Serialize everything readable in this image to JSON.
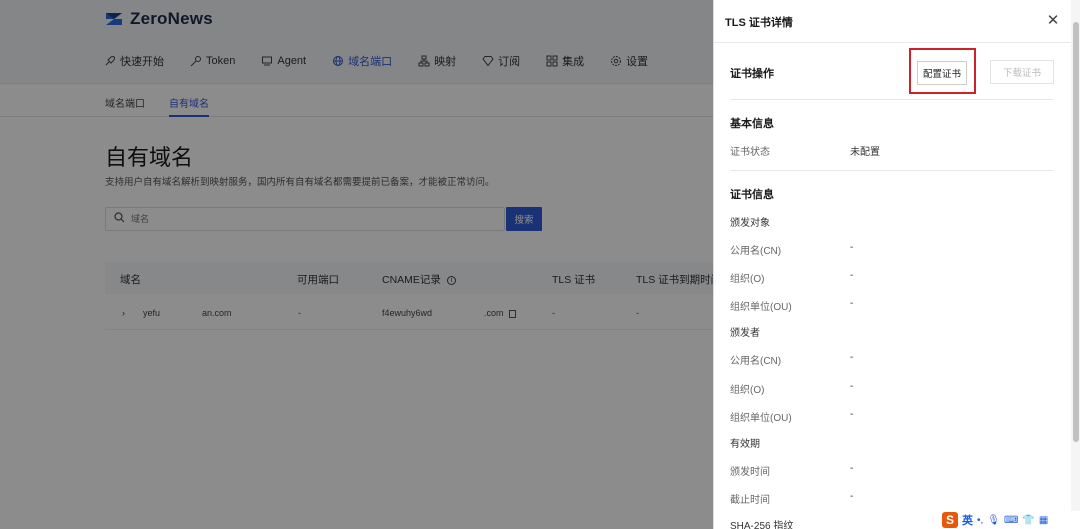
{
  "app": {
    "logo_text": "ZeroNews",
    "nav": [
      {
        "label": "快速开始",
        "icon": "rocket-icon"
      },
      {
        "label": "Token",
        "icon": "key-icon"
      },
      {
        "label": "Agent",
        "icon": "monitor-icon"
      },
      {
        "label": "域名端口",
        "icon": "globe-icon",
        "active": true
      },
      {
        "label": "映射",
        "icon": "network-icon"
      },
      {
        "label": "订阅",
        "icon": "diamond-icon"
      },
      {
        "label": "集成",
        "icon": "grid-icon"
      },
      {
        "label": "设置",
        "icon": "gear-icon"
      }
    ],
    "subtabs": [
      {
        "label": "域名端口"
      },
      {
        "label": "自有域名",
        "active": true
      }
    ],
    "page_title": "自有域名",
    "page_desc": "支持用户自有域名解析到映射服务，国内所有自有域名都需要提前已备案，才能被正常访问。",
    "search": {
      "placeholder": "域名",
      "button": "搜索"
    },
    "table": {
      "headers": [
        "域名",
        "可用端口",
        "CNAME记录",
        "TLS 证书",
        "TLS 证书到期时间"
      ],
      "rows": [
        {
          "domain_prefix": "yefu",
          "domain_suffix": "an.com",
          "port": "-",
          "cname_prefix": "f4ewuhy6wd",
          "cname_suffix": ".com",
          "tls": "-",
          "expire": "-"
        }
      ]
    }
  },
  "drawer": {
    "title": "TLS 证书详情",
    "ops_title": "证书操作",
    "config_btn": "配置证书",
    "download_btn": "下载证书",
    "basic_title": "基本信息",
    "status_label": "证书状态",
    "status_value": "未配置",
    "cert_title": "证书信息",
    "issued_to": "颁发对象",
    "issuer": "颁发者",
    "validity": "有效期",
    "cn_label": "公用名(CN)",
    "o_label": "组织(O)",
    "ou_label": "组织单位(OU)",
    "issue_time": "颁发时间",
    "expire_time": "截止时间",
    "sha": "SHA-256 指纹",
    "dash": "-"
  },
  "ime": {
    "logo": "S",
    "lang": "英"
  }
}
